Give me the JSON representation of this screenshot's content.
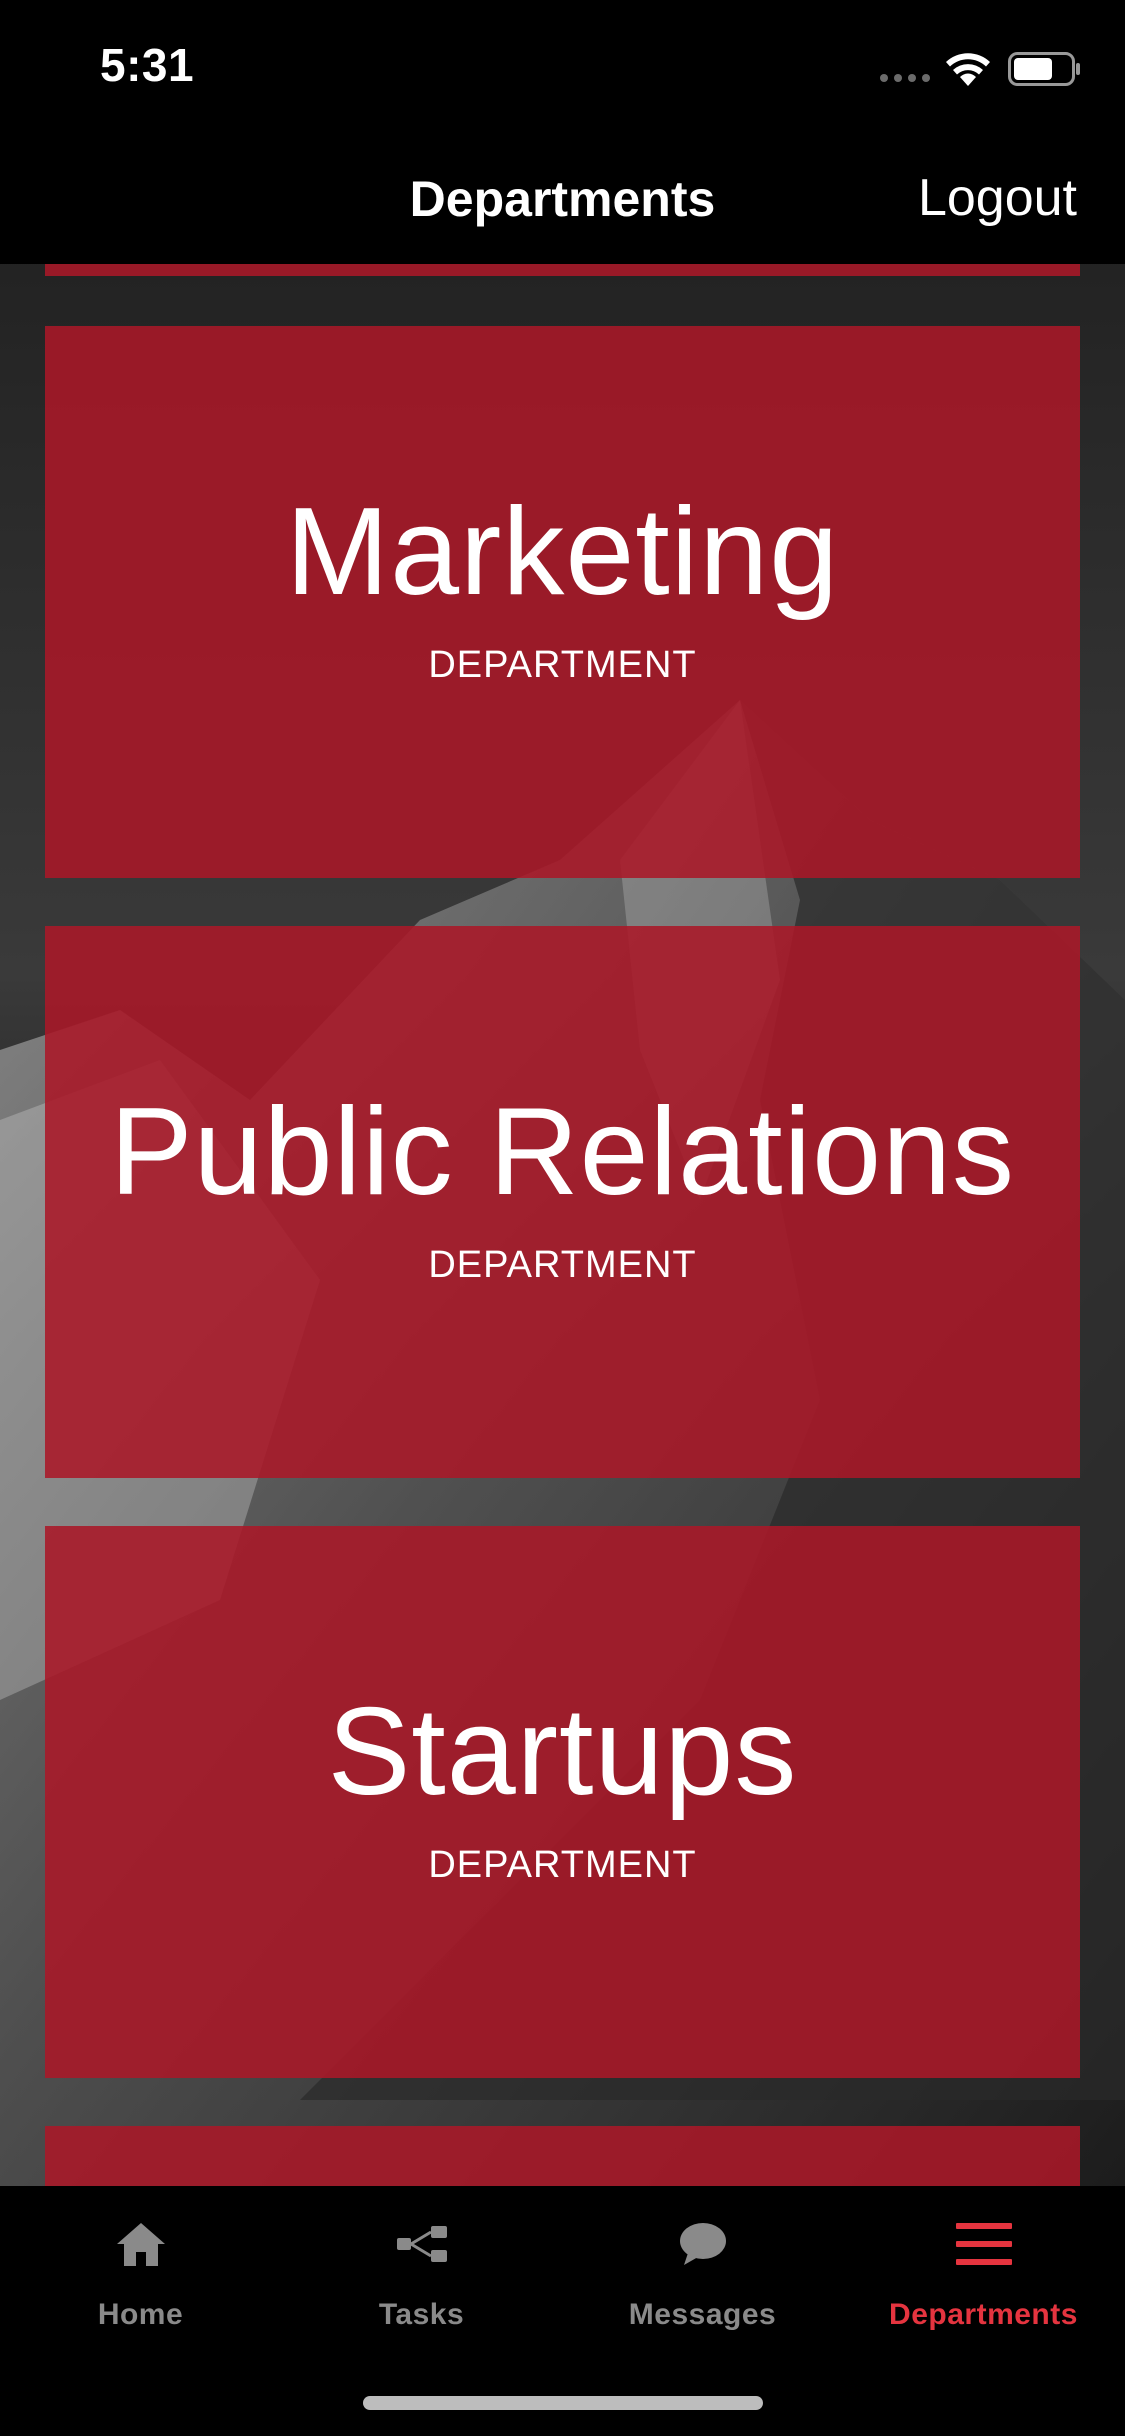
{
  "status_bar": {
    "time": "5:31"
  },
  "nav_bar": {
    "title": "Departments",
    "logout_label": "Logout"
  },
  "departments": [
    {
      "name": "Marketing",
      "subtitle": "DEPARTMENT"
    },
    {
      "name": "Public Relations",
      "subtitle": "DEPARTMENT"
    },
    {
      "name": "Startups",
      "subtitle": "DEPARTMENT"
    }
  ],
  "tab_bar": {
    "tabs": [
      {
        "label": "Home",
        "icon": "home-icon",
        "active": false
      },
      {
        "label": "Tasks",
        "icon": "share-nodes-icon",
        "active": false
      },
      {
        "label": "Messages",
        "icon": "chat-bubble-icon",
        "active": false
      },
      {
        "label": "Departments",
        "icon": "hamburger-menu-icon",
        "active": true
      }
    ]
  },
  "colors": {
    "accent": "#e5343f",
    "card": "#aa1828",
    "inactive": "#8a8a8a",
    "background": "#000000"
  }
}
